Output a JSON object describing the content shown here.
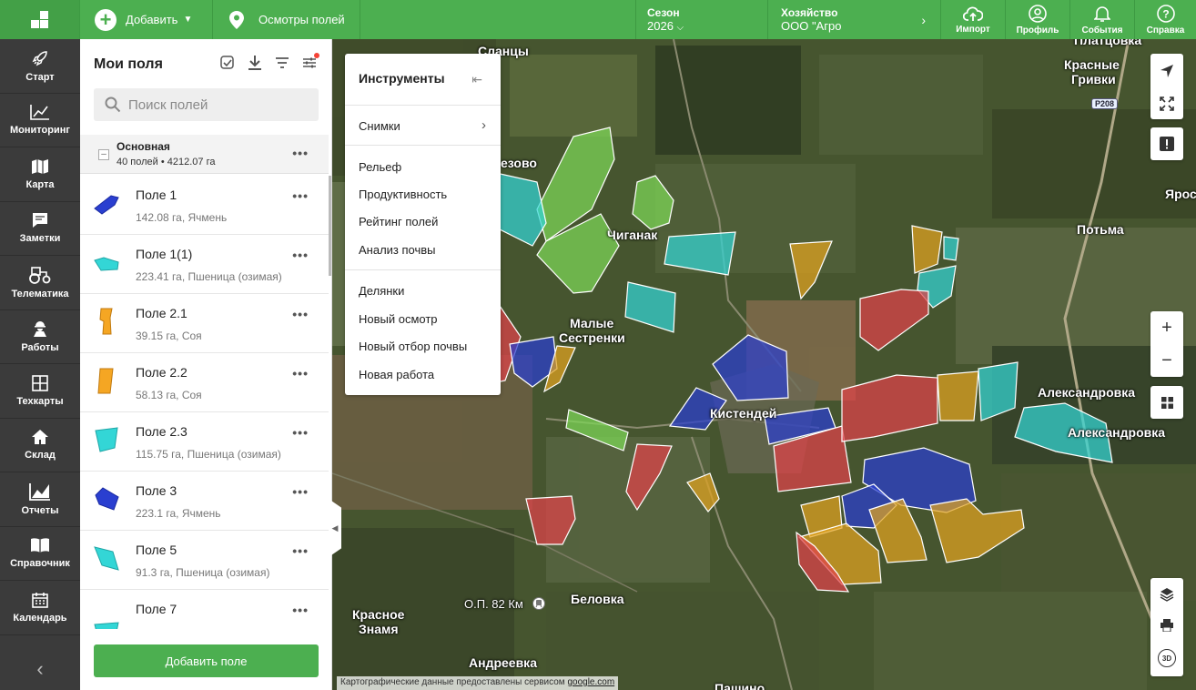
{
  "topbar": {
    "add_label": "Добавить",
    "inspections_label": "Осмотры полей",
    "season_label": "Сезон",
    "season_value": "2026",
    "farm_label": "Хозяйство",
    "farm_value": "ООО \"Агро",
    "import_label": "Импорт",
    "profile_label": "Профиль",
    "events_label": "События",
    "help_label": "Справка"
  },
  "nav": [
    {
      "label": "Старт",
      "icon": "rocket-icon"
    },
    {
      "label": "Мониторинг",
      "icon": "chart-icon"
    },
    {
      "label": "Карта",
      "icon": "map-icon"
    },
    {
      "label": "Заметки",
      "icon": "note-icon"
    },
    {
      "label": "Телематика",
      "icon": "tractor-icon"
    },
    {
      "label": "Работы",
      "icon": "worker-icon"
    },
    {
      "label": "Техкарты",
      "icon": "grid-icon"
    },
    {
      "label": "Склад",
      "icon": "home-icon"
    },
    {
      "label": "Отчеты",
      "icon": "report-icon"
    },
    {
      "label": "Справочник",
      "icon": "book-icon"
    },
    {
      "label": "Календарь",
      "icon": "calendar-icon"
    }
  ],
  "panel": {
    "title": "Мои поля",
    "search_placeholder": "Поиск полей",
    "group_name": "Основная",
    "group_info": "40 полей  •  4212.07 га",
    "add_button": "Добавить поле",
    "fields": [
      {
        "name": "Поле 1",
        "info": "142.08 га, Ячмень",
        "color": "#2a3fd0"
      },
      {
        "name": "Поле 1(1)",
        "info": "223.41 га, Пшеница (озимая)",
        "color": "#33d6d6"
      },
      {
        "name": "Поле 2.1",
        "info": "39.15 га, Соя",
        "color": "#f5a623"
      },
      {
        "name": "Поле 2.2",
        "info": "58.13 га, Соя",
        "color": "#f5a623"
      },
      {
        "name": "Поле 2.3",
        "info": "115.75 га, Пшеница (озимая)",
        "color": "#33d6d6"
      },
      {
        "name": "Поле 3",
        "info": "223.1 га, Ячмень",
        "color": "#2a3fd0"
      },
      {
        "name": "Поле 5",
        "info": "91.3 га, Пшеница (озимая)",
        "color": "#33d6d6"
      },
      {
        "name": "Поле 7",
        "info": "",
        "color": "#33d6d6"
      }
    ]
  },
  "tools": {
    "title": "Инструменты",
    "images": "Снимки",
    "relief": "Рельеф",
    "productivity": "Продуктивность",
    "rating": "Рейтинг полей",
    "soil": "Анализ почвы",
    "plots": "Делянки",
    "new_inspection": "Новый осмотр",
    "new_soil": "Новый отбор почвы",
    "new_work": "Новая работа"
  },
  "map": {
    "labels": {
      "slantsy": "Сланцы",
      "platsovka": "Платцовка",
      "krasnye": "Красные",
      "grivki": "Гривки",
      "ezovo": "езово",
      "chiganak": "Чиганак",
      "potma": "Потьма",
      "yaros": "Ярос",
      "malye": "Малые",
      "sestrenki": "Сестренки",
      "aleks1": "Александровка",
      "aleks2": "Александровка",
      "kistendey": "Кистендей",
      "op82": "О.П. 82 Км",
      "belovka": "Беловка",
      "krasnoe": "Красное",
      "znamya": "Знамя",
      "andreevka": "Андреевка",
      "pashino": "Пашино"
    },
    "road": "Р208",
    "attribution": "Картографические данные предоставлены сервисом",
    "attribution_link": "google.com",
    "btn_3d": "3D"
  }
}
